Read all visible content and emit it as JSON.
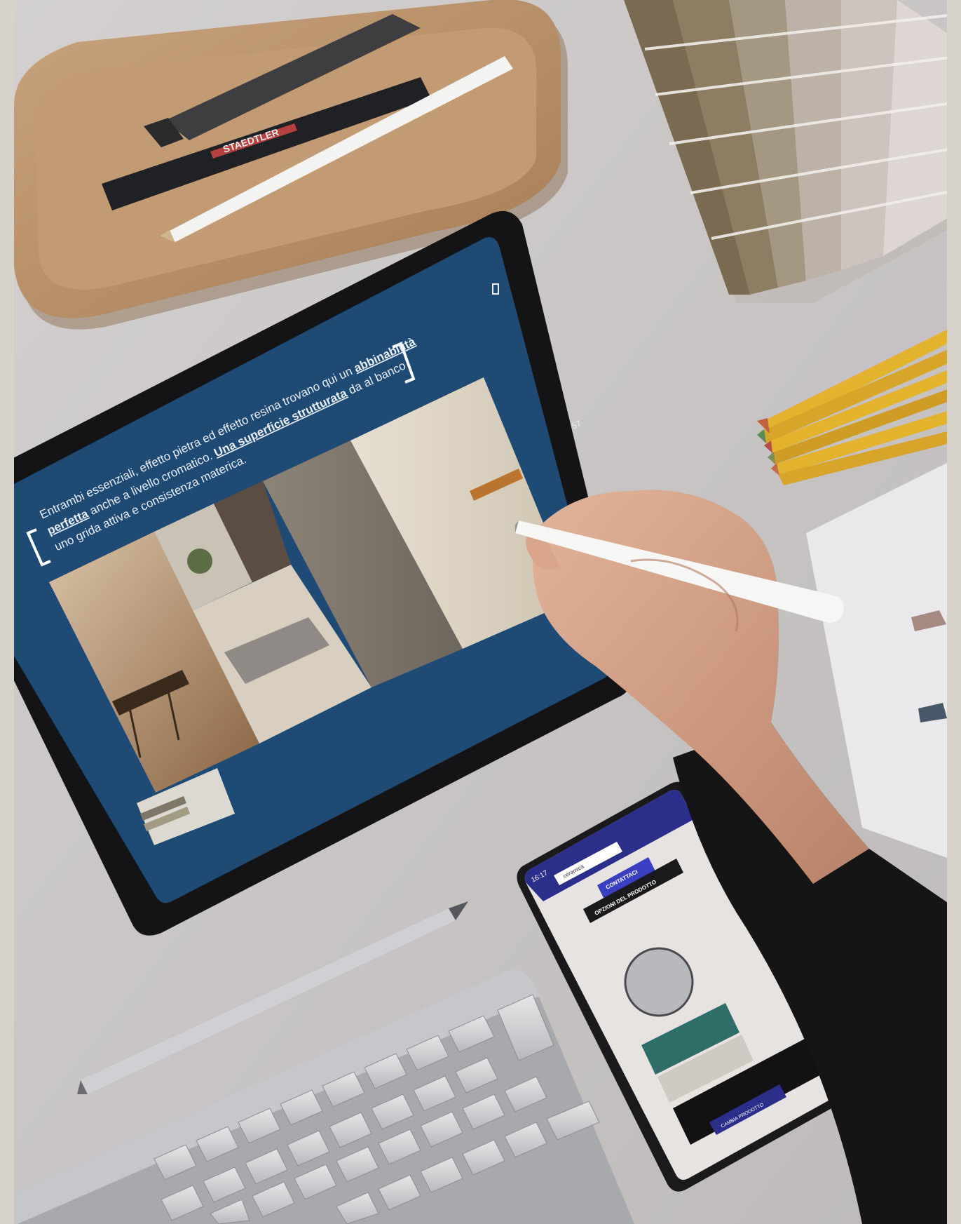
{
  "colors": {
    "page_border": "#d7d2ca",
    "desk": "#c9c6c5",
    "slide_background": "#1f4a73",
    "tray_wood": "#b88f67"
  },
  "tablet_slide": {
    "text_line_1": "Entrambi essenziali, effetto pietra ed effetto resina trovano qui un",
    "text_bold_1": "abbinabilità",
    "text_line_2a": "perfetta",
    "text_line_2b": "anche a livello cromatico.",
    "text_bold_2": "Una superficie strutturata",
    "text_line_2c": "da al banco",
    "text_line_3": "uno grida attiva e consistenza materica.",
    "page_number": "57"
  },
  "pen_brand": "STAEDTLER",
  "phone": {
    "status_time": "16:17",
    "url_text": "ceramica",
    "contact_button": "CONTATTACI",
    "options_button": "OPZIONI DEL PRODOTTO",
    "bottom_button": "CAMBIA PRODOTTO"
  }
}
